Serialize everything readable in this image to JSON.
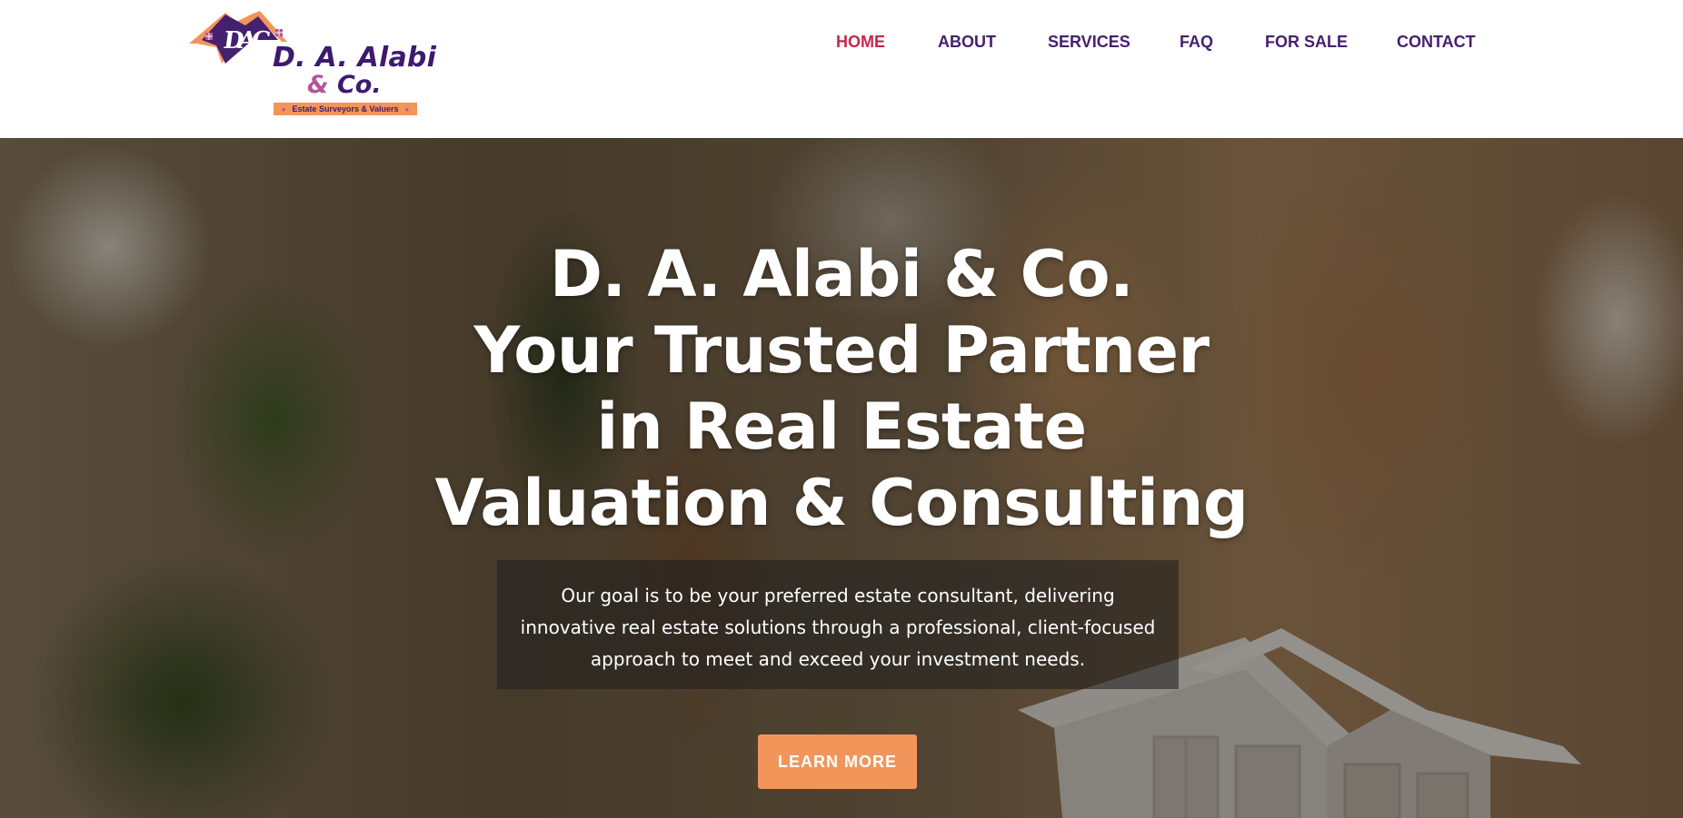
{
  "colors": {
    "brand_purple": "#45206f",
    "active_red": "#c4274e",
    "accent_orange": "#f2955a",
    "white": "#ffffff"
  },
  "logo": {
    "monogram": "DAC",
    "name_line1": "D. A. Alabi",
    "name_amp": "&",
    "name_line2": "Co.",
    "tagline": "Estate Surveyors & Valuers"
  },
  "nav": {
    "items": [
      {
        "label": "HOME",
        "active": true
      },
      {
        "label": "ABOUT",
        "active": false
      },
      {
        "label": "SERVICES",
        "active": false
      },
      {
        "label": "FAQ",
        "active": false
      },
      {
        "label": "FOR SALE",
        "active": false
      },
      {
        "label": "CONTACT",
        "active": false
      }
    ]
  },
  "hero": {
    "headline_lines": [
      "D. A. Alabi & Co.",
      "Your Trusted Partner",
      "in Real Estate",
      "Valuation & Consulting"
    ],
    "description": "Our goal is to be your preferred estate consultant, delivering innovative real estate solutions through a professional, client-focused approach to meet and exceed your investment needs.",
    "cta_label": "LEARN MORE"
  }
}
